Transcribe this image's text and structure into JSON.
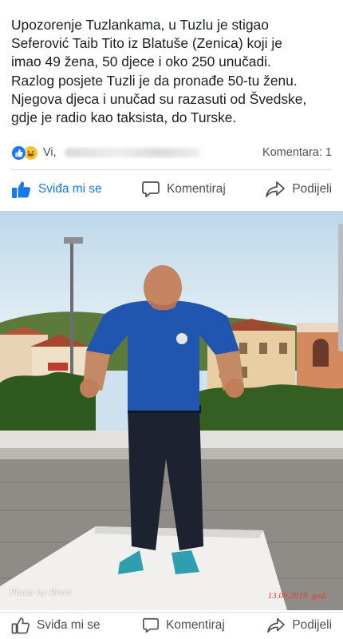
{
  "post": {
    "text_lines": [
      "Upozorenje Tuzlankama, u Tuzlu je stigao",
      "Seferović Taib Tito iz Blatuše (Zenica) koji je",
      "imao 49 žena, 50 djece i oko 250 unučadi.",
      "Razlog posjete Tuzli je da pronađe 50-tu ženu.",
      "Njegova djeca i unučad su razasuti od Švedske,",
      "gdje je radio kao taksista, do Turske."
    ]
  },
  "reactions": {
    "icons": [
      "like-icon",
      "haha-icon"
    ],
    "reactors_prefix": "Vi, ",
    "comments_label": "Komentara: 1"
  },
  "actions": {
    "like_label": "Sviđa mi se",
    "comment_label": "Komentiraj",
    "share_label": "Podijeli"
  },
  "photo": {
    "watermark_left": "Photo by River",
    "watermark_right": "13.09.2019. god."
  },
  "colors": {
    "accent": "#1877f2",
    "text": "#1c1e21",
    "secondary_text": "#4b4f56",
    "divider": "#dadde1",
    "date_stamp": "#e33b2e"
  }
}
